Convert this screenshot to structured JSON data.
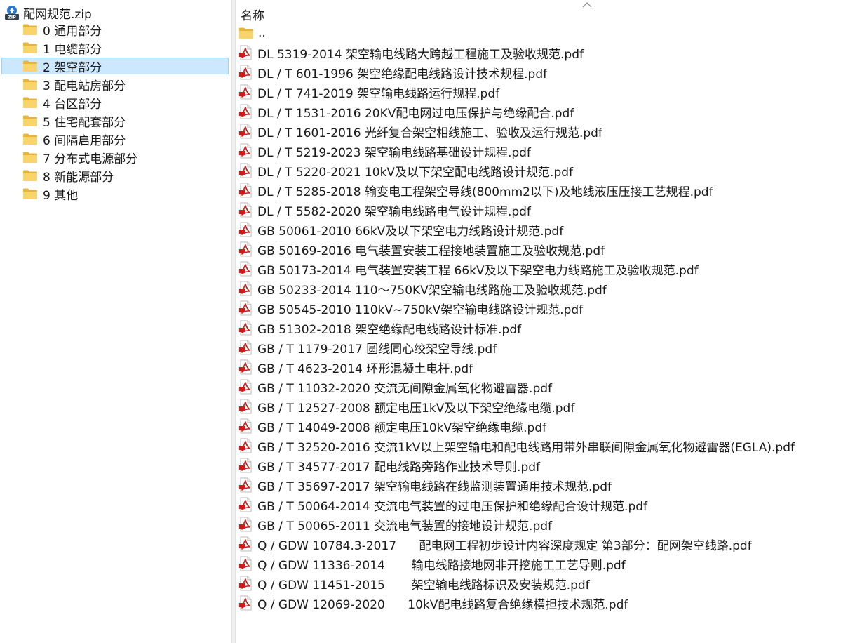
{
  "colors": {
    "selection_bg": "#cce8ff",
    "selection_border": "#99d1ff",
    "folder": "#f8d46a",
    "pdf_red": "#d21a1a",
    "zip_badge": "#2b79d0"
  },
  "tree": {
    "root": {
      "label": "配网规范.zip",
      "icon": "zip-archive-icon"
    },
    "items": [
      {
        "label": "0 通用部分",
        "icon": "folder-icon",
        "selected": false
      },
      {
        "label": "1 电缆部分",
        "icon": "folder-icon",
        "selected": false
      },
      {
        "label": "2 架空部分",
        "icon": "folder-icon",
        "selected": true
      },
      {
        "label": "3 配电站房部分",
        "icon": "folder-icon",
        "selected": false
      },
      {
        "label": "4 台区部分",
        "icon": "folder-icon",
        "selected": false
      },
      {
        "label": "5 住宅配套部分",
        "icon": "folder-icon",
        "selected": false
      },
      {
        "label": "6 间隔启用部分",
        "icon": "folder-icon",
        "selected": false
      },
      {
        "label": "7 分布式电源部分",
        "icon": "folder-icon",
        "selected": false
      },
      {
        "label": "8 新能源部分",
        "icon": "folder-icon",
        "selected": false
      },
      {
        "label": "9 其他",
        "icon": "folder-icon",
        "selected": false
      }
    ]
  },
  "file_list": {
    "column_header": "名称",
    "sort_icon": "sort-ascending-icon",
    "parent": {
      "label": "..",
      "icon": "folder-icon"
    },
    "files": [
      "DL 5319-2014 架空输电线路大跨越工程施工及验收规范.pdf",
      "DL / T 601-1996 架空绝缘配电线路设计技术规程.pdf",
      "DL / T 741-2019 架空输电线路运行规程.pdf",
      "DL / T 1531-2016 20KV配电网过电压保护与绝缘配合.pdf",
      "DL / T 1601-2016 光纤复合架空相线施工、验收及运行规范.pdf",
      "DL / T 5219-2023 架空输电线路基础设计规程.pdf",
      "DL / T 5220-2021 10kV及以下架空配电线路设计规范.pdf",
      "DL / T 5285-2018 输变电工程架空导线(800mm2以下)及地线液压压接工艺规程.pdf",
      "DL / T 5582-2020 架空输电线路电气设计规程.pdf",
      "GB 50061-2010 66kV及以下架空电力线路设计规范.pdf",
      "GB 50169-2016 电气装置安装工程接地装置施工及验收规范.pdf",
      "GB 50173-2014 电气装置安装工程 66kV及以下架空电力线路施工及验收规范.pdf",
      "GB 50233-2014 110～750KV架空输电线路施工及验收规范.pdf",
      "GB 50545-2010 110kV~750kV架空输电线路设计规范.pdf",
      "GB 51302-2018 架空绝缘配电线路设计标准.pdf",
      "GB / T 1179-2017 圆线同心绞架空导线.pdf",
      "GB / T 4623-2014 环形混凝土电杆.pdf",
      "GB / T 11032-2020 交流无间隙金属氧化物避雷器.pdf",
      "GB / T 12527-2008 额定电压1kV及以下架空绝缘电缆.pdf",
      "GB / T 14049-2008 额定电压10kV架空绝缘电缆.pdf",
      "GB / T 32520-2016 交流1kV以上架空输电和配电线路用带外串联间隙金属氧化物避雷器(EGLA).pdf",
      "GB / T 34577-2017 配电线路旁路作业技术导则.pdf",
      "GB / T 35697-2017 架空输电线路在线监测装置通用技术规范.pdf",
      "GB / T 50064-2014 交流电气装置的过电压保护和绝缘配合设计规范.pdf",
      "GB / T 50065-2011 交流电气装置的接地设计规范.pdf",
      "Q / GDW 10784.3-2017      配电网工程初步设计内容深度规定 第3部分：配网架空线路.pdf",
      "Q / GDW 11336-2014       输电线路接地网非开挖施工工艺导则.pdf",
      "Q / GDW 11451-2015       架空输电线路标识及安装规范.pdf",
      "Q / GDW 12069-2020      10kV配电线路复合绝缘横担技术规范.pdf"
    ]
  }
}
